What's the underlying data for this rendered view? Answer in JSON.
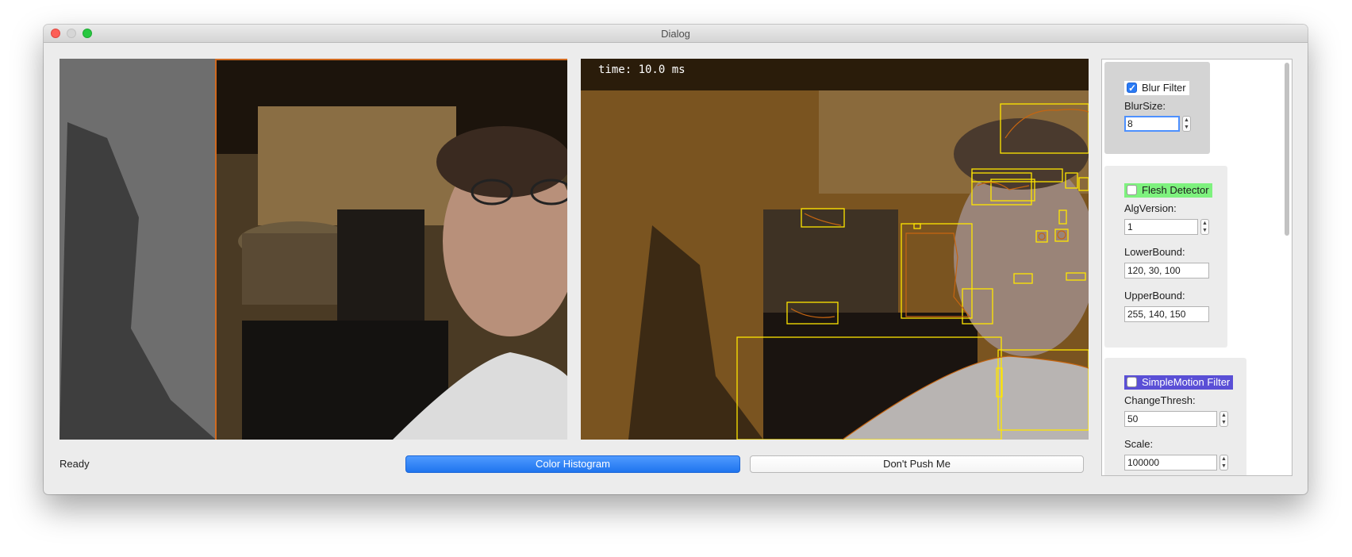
{
  "window": {
    "title": "Dialog"
  },
  "video": {
    "timing_overlay": "time: 10.0 ms"
  },
  "status": {
    "text": "Ready"
  },
  "buttons": {
    "color_histogram": "Color Histogram",
    "dont_push_me": "Don't Push Me"
  },
  "filters": {
    "blur": {
      "label": "Blur Filter",
      "checked": true,
      "blur_size_label": "BlurSize:",
      "blur_size_value": "8",
      "color": "#ffffff"
    },
    "flesh": {
      "label": "Flesh Detector",
      "checked": false,
      "alg_version_label": "AlgVersion:",
      "alg_version_value": "1",
      "lower_bound_label": "LowerBound:",
      "lower_bound_value": "120, 30, 100",
      "upper_bound_label": "UpperBound:",
      "upper_bound_value": "255, 140, 150",
      "color": "#7ef27e"
    },
    "motion": {
      "label": "SimpleMotion Filter",
      "checked": false,
      "change_thresh_label": "ChangeThresh:",
      "change_thresh_value": "50",
      "scale_label": "Scale:",
      "scale_value": "100000",
      "color": "#5a4fd6"
    }
  }
}
